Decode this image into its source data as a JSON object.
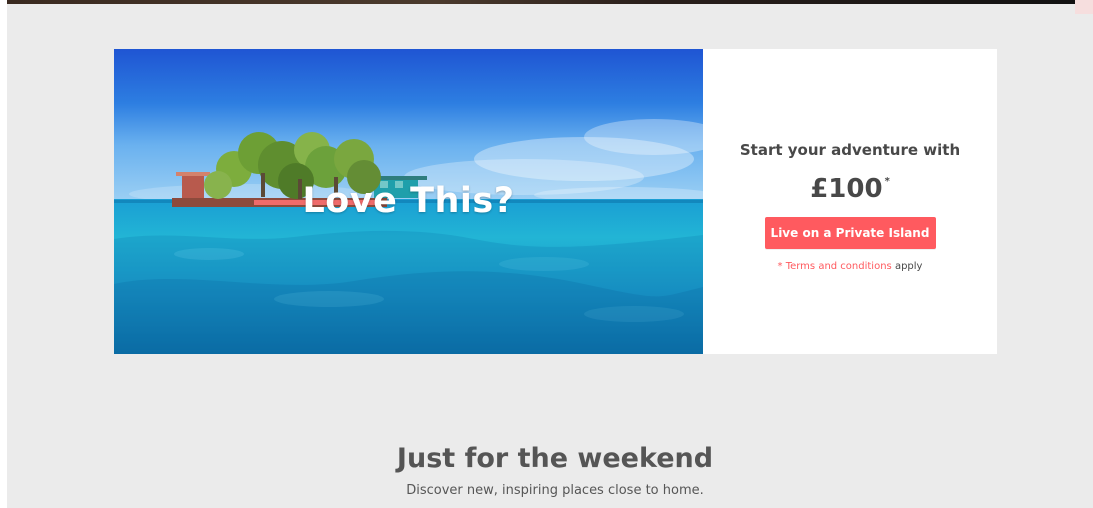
{
  "promo": {
    "image_title": "Love This?",
    "offer_intro": "Start your adventure with",
    "price": "£100",
    "price_asterisk": "*",
    "cta_label": "Live on a Private Island",
    "terms_prefix": "*",
    "terms_link": "Terms and conditions",
    "terms_suffix": "apply"
  },
  "weekend": {
    "title": "Just for the weekend",
    "subtitle": "Discover new, inspiring places close to home."
  },
  "icons": {
    "hero_image": "private-island-photo"
  },
  "colors": {
    "page_background": "#ebebeb",
    "accent": "#ff5a5f",
    "text": "#484848"
  }
}
